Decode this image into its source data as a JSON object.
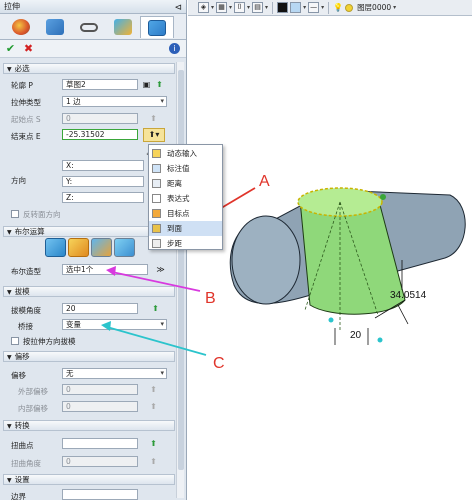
{
  "window": {
    "title": "拉伸"
  },
  "tabs": [
    "properties-tab",
    "feature-tab",
    "view-tab",
    "color-tab",
    "active-tab"
  ],
  "sections": {
    "required": "必选",
    "boolean": "布尔运算",
    "draft": "拔模",
    "offset": "偏移",
    "twist": "转换",
    "settings": "设置"
  },
  "fields": {
    "profile_label": "轮廓 P",
    "profile_value": "草图2",
    "extrude_type_label": "拉伸类型",
    "extrude_type_value": "1 边",
    "start_label": "起始点 S",
    "start_value": "0",
    "end_label": "结束点 E",
    "end_value": "-25.31502",
    "direction_label": "方向",
    "dir_x": "X:",
    "dir_y": "Y:",
    "dir_z": "Z:",
    "reverse_label": "反转面方向",
    "bool_type_label": "布尔造型",
    "bool_type_value": "选中1个",
    "draft_angle_label": "拔模角度",
    "draft_angle_value": "20",
    "bridge_label": "桥接",
    "bridge_value": "变量",
    "draft_dir_label": "按拉伸方向拔模",
    "offset_label": "偏移",
    "offset_value": "无",
    "outer_offset_label": "外部偏移",
    "outer_offset_value": "0",
    "inner_offset_label": "内部偏移",
    "inner_offset_value": "0",
    "twist_point_label": "扭曲点",
    "twist_angle_label": "扭曲角度",
    "twist_angle_value": "0",
    "settings_first_label": "边界"
  },
  "popup_menu": [
    "动态输入",
    "标注值",
    "距离",
    "表达式",
    "目标点",
    "到面",
    "步距"
  ],
  "toolbar": {
    "layer": "图层0000"
  },
  "annotations": {
    "a": "A",
    "b": "B",
    "c": "C"
  },
  "dimensions": {
    "d1": "34.0514",
    "d2": "20"
  },
  "colors": {
    "accent_red": "#e0342a",
    "arrow_magenta": "#d83adf",
    "arrow_cyan": "#2bc4cc",
    "model_green": "#8fd87a",
    "model_gray": "#8fa3b4"
  }
}
